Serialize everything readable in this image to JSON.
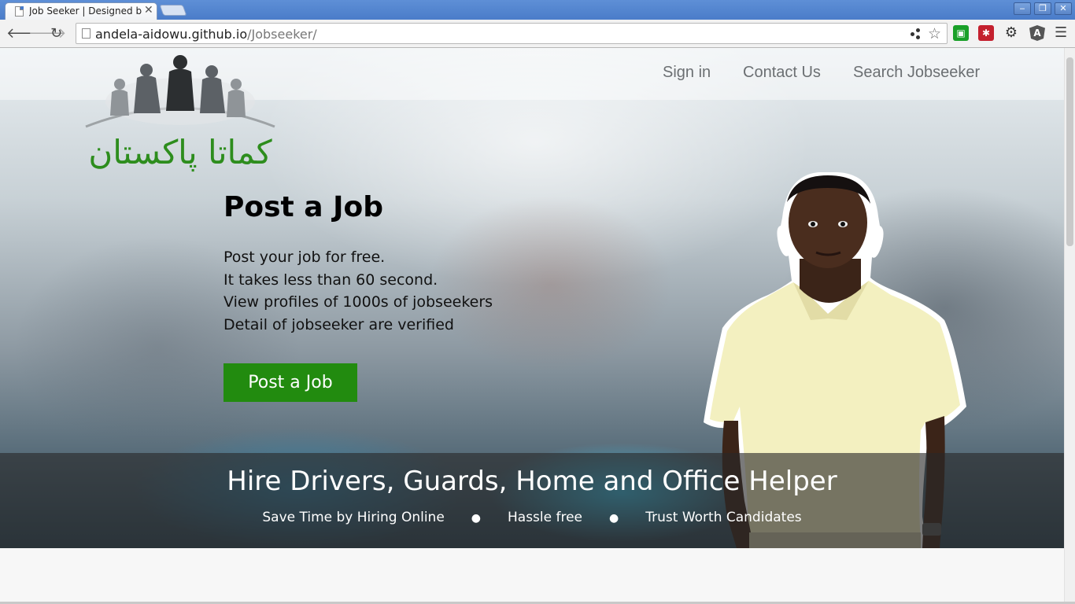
{
  "browser": {
    "tab_title": "Job Seeker | Designed by",
    "url_host": "andela-aidowu.github.io",
    "url_path": "/Jobseeker/"
  },
  "nav": {
    "sign_in": "Sign in",
    "contact_us": "Contact Us",
    "search": "Search Jobseeker"
  },
  "logo": {
    "text": "کماتا پاکستان"
  },
  "hero": {
    "title": "Post a Job",
    "lines": [
      "Post your job for free.",
      "It takes less than 60 second.",
      "View profiles of 1000s of jobseekers",
      "Detail of jobseeker are verified"
    ],
    "button_label": "Post a Job"
  },
  "banner": {
    "title": "Hire Drivers, Guards, Home and Office Helper",
    "items": [
      "Save Time by Hiring Online",
      "Hassle free",
      "Trust Worth Candidates"
    ]
  },
  "colors": {
    "brand_green": "#228b0f",
    "logo_green": "#2d8d1d",
    "chrome_blue": "#4a7cc9"
  },
  "icons": [
    "page-icon",
    "close-icon",
    "back-arrow-icon",
    "forward-arrow-icon",
    "reload-icon",
    "star-icon",
    "puzzle-extension-icon",
    "gear-icon",
    "angular-icon",
    "menu-icon"
  ]
}
